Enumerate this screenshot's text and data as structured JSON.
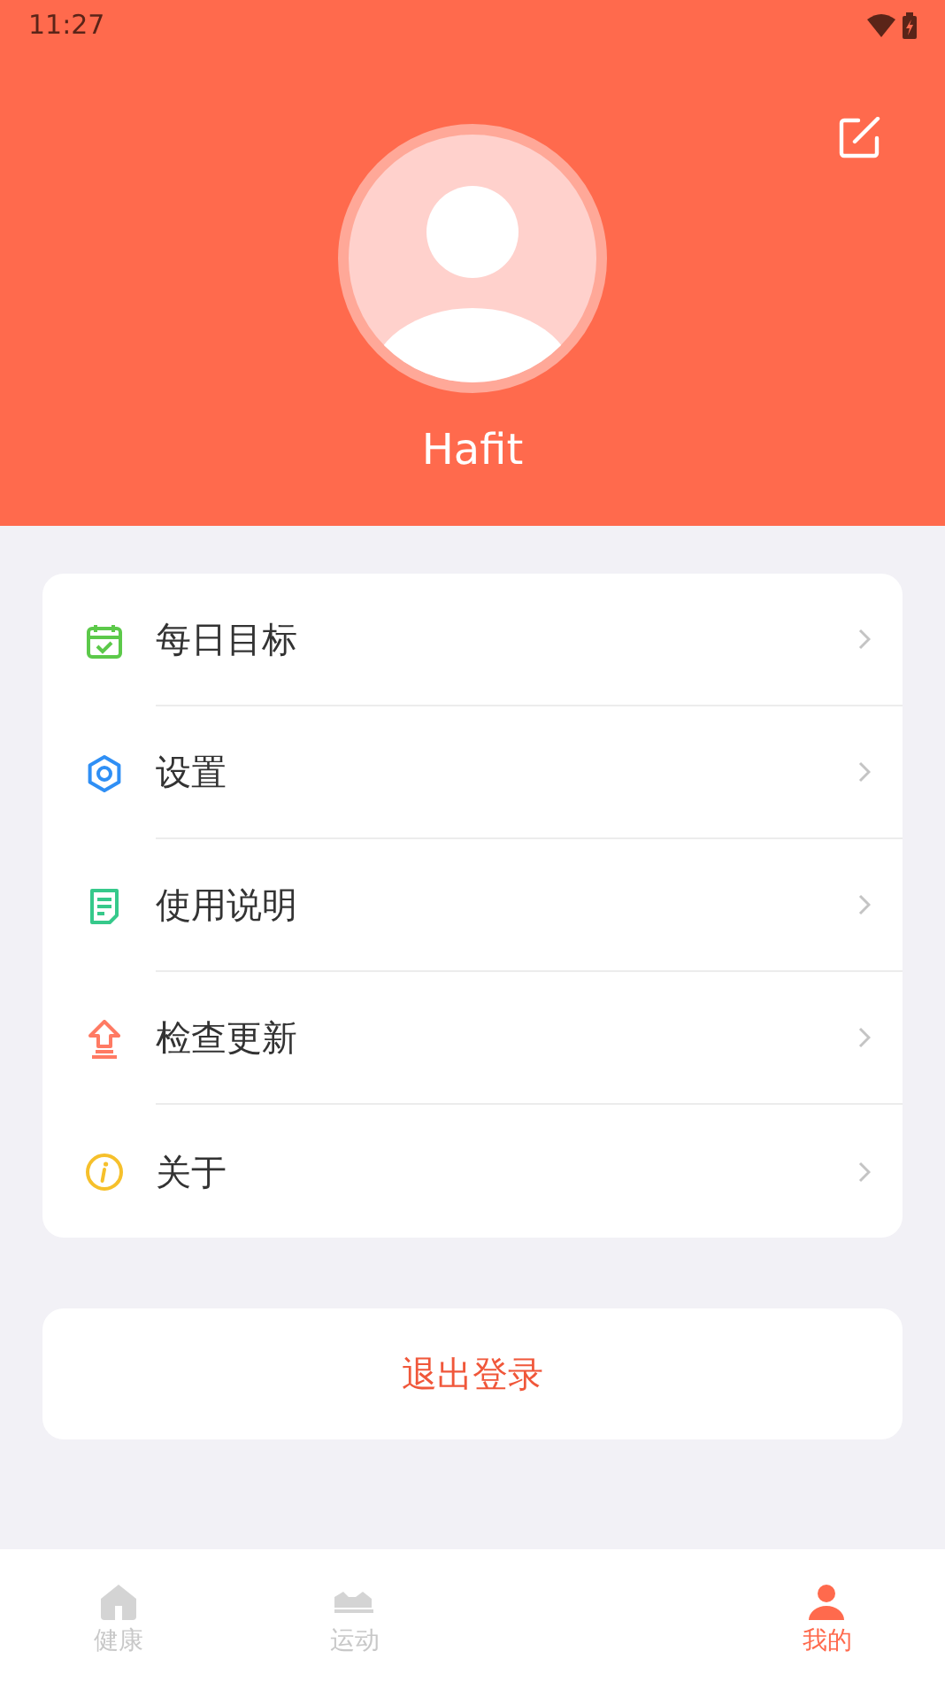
{
  "status_bar": {
    "time": "11:27"
  },
  "profile": {
    "name": "Hafit"
  },
  "menu": [
    {
      "kind": "goal",
      "label": "每日目标"
    },
    {
      "kind": "settings",
      "label": "设置"
    },
    {
      "kind": "manual",
      "label": "使用说明"
    },
    {
      "kind": "update",
      "label": "检查更新"
    },
    {
      "kind": "about",
      "label": "关于"
    }
  ],
  "logout": {
    "label": "退出登录"
  },
  "tabs": [
    {
      "kind": "home",
      "label": "健康",
      "selected": false
    },
    {
      "kind": "shoe",
      "label": "运动",
      "selected": false
    },
    {
      "kind": "person",
      "label": "我的",
      "selected": true
    }
  ]
}
